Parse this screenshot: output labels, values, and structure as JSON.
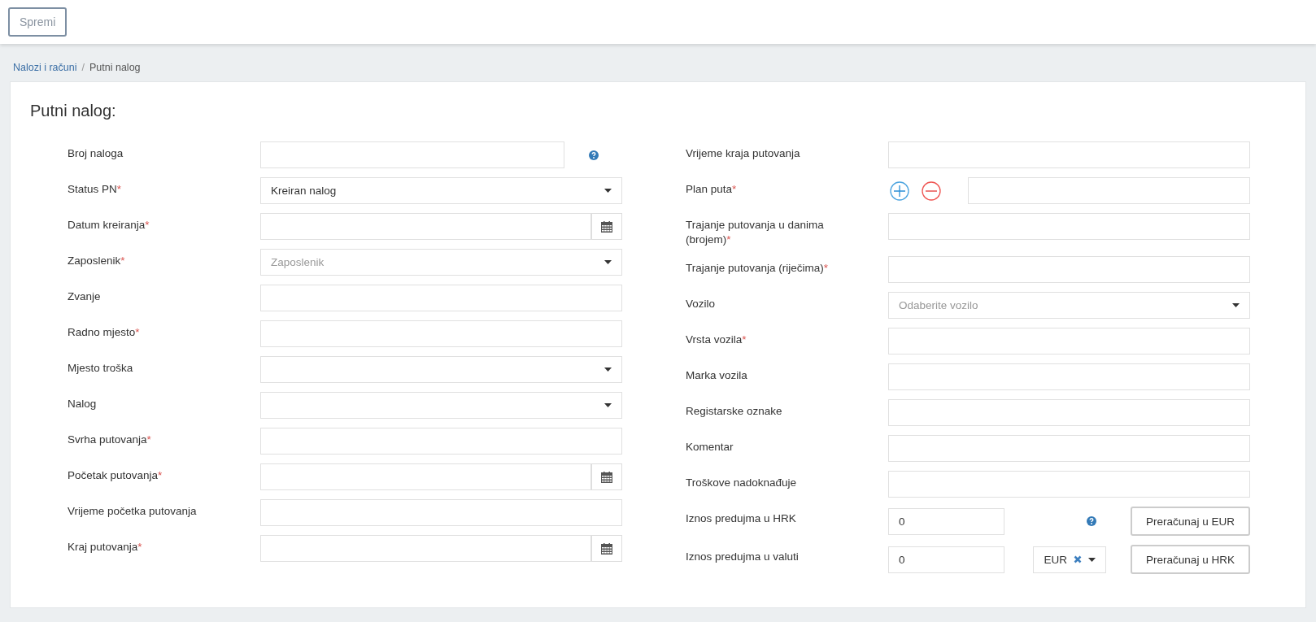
{
  "top_bar": {
    "save_button": "Spremi"
  },
  "breadcrumb": {
    "separator": "/",
    "items": [
      {
        "label": "Nalozi i računi",
        "kind": "link"
      },
      {
        "label": "Putni nalog",
        "kind": "current"
      }
    ]
  },
  "form": {
    "title": "Putni nalog:",
    "left_fields": [
      {
        "label": "Broj naloga",
        "kind": "text",
        "help": true
      },
      {
        "label": "Status PN",
        "required_mark": "*",
        "kind": "select",
        "value": "Kreiran nalog"
      },
      {
        "label": "Datum kreiranja",
        "required_mark": "*",
        "kind": "date"
      },
      {
        "label": "Zaposlenik",
        "required_mark": "*",
        "kind": "select",
        "placeholder": "Zaposlenik"
      },
      {
        "label": "Zvanje",
        "kind": "text"
      },
      {
        "label": "Radno mjesto",
        "required_mark": "*",
        "kind": "text"
      },
      {
        "label": "Mjesto troška",
        "kind": "select"
      },
      {
        "label": "Nalog",
        "kind": "select"
      },
      {
        "label": "Svrha putovanja",
        "required_mark": "*",
        "kind": "text"
      },
      {
        "label": "Početak putovanja",
        "required_mark": "*",
        "kind": "date"
      },
      {
        "label": "Vrijeme početka putovanja",
        "kind": "text"
      },
      {
        "label": "Kraj putovanja",
        "required_mark": "*",
        "kind": "date"
      }
    ],
    "right_fields": [
      {
        "label": "Vrijeme kraja putovanja",
        "kind": "text"
      },
      {
        "label": "Plan puta",
        "required_mark": "*",
        "kind": "plan"
      },
      {
        "label": "Trajanje putovanja u danima (brojem)",
        "required_mark": "*",
        "kind": "text"
      },
      {
        "label": "Trajanje putovanja (riječima)",
        "required_mark": "*",
        "kind": "text"
      },
      {
        "label": "Vozilo",
        "kind": "select",
        "placeholder": "Odaberite vozilo"
      },
      {
        "label": "Vrsta vozila",
        "required_mark": "*",
        "kind": "text"
      },
      {
        "label": "Marka vozila",
        "kind": "text"
      },
      {
        "label": "Registarske oznake",
        "kind": "text"
      },
      {
        "label": "Komentar",
        "kind": "text"
      },
      {
        "label": "Troškove nadoknađuje",
        "kind": "text"
      },
      {
        "label": "Iznos predujma u HRK",
        "kind": "amount",
        "value": "0",
        "help": true,
        "button": "Preračunaj u EUR"
      },
      {
        "label": "Iznos predujma u valuti",
        "kind": "currency",
        "value": "0",
        "currency": "EUR",
        "button": "Preračunaj u HRK"
      }
    ]
  }
}
